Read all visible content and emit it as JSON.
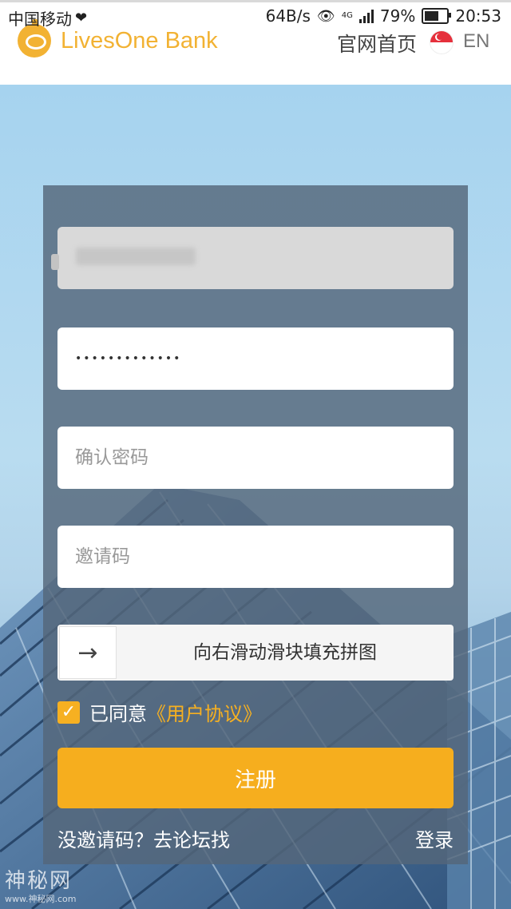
{
  "status_bar": {
    "carrier": "中国移动",
    "speed": "64B/s",
    "network": "4G",
    "battery": "79%",
    "battery_level": 0.79,
    "time": "20:53"
  },
  "header": {
    "logo_text": "LivesOne Bank",
    "home_link": "官网首页",
    "language": "EN"
  },
  "form": {
    "confirm_placeholder": "确认密码",
    "invite_placeholder": "邀请码",
    "password_value": "•••••••••••••",
    "slider_arrow": "→",
    "slider_hint": "向右滑动滑块填充拼图",
    "agree_text": "已同意",
    "agreement_link": "《用户协议》",
    "checkbox_mark": "✓",
    "submit_label": "注册",
    "no_invite_text": "没邀请码？去论坛找",
    "login_link": "登录"
  },
  "watermark": {
    "text": "神秘网",
    "sub": "www.神秘网.com"
  },
  "colors": {
    "brand": "#f2b233",
    "button": "#f6ae1e",
    "card": "#54677a"
  }
}
